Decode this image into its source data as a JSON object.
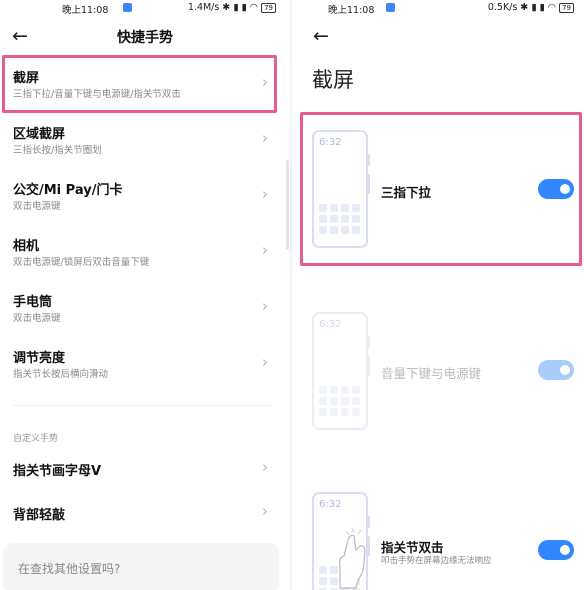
{
  "status_left": {
    "time": "晚上11:08",
    "speed": "1.4M/s",
    "battery": "79"
  },
  "status_right": {
    "time": "晚上11:08",
    "speed": "0.5K/s",
    "battery": "79"
  },
  "left": {
    "title": "快捷手势",
    "items": [
      {
        "title": "截屏",
        "subtitle": "三指下拉/音量下键与电源键/指关节双击"
      },
      {
        "title": "区域截屏",
        "subtitle": "三指长按/指关节圈划"
      },
      {
        "title": "公交/Mi Pay/门卡",
        "subtitle": "双击电源键"
      },
      {
        "title": "相机",
        "subtitle": "双击电源键/锁屏后双击音量下键"
      },
      {
        "title": "手电筒",
        "subtitle": "双击电源键"
      },
      {
        "title": "调节亮度",
        "subtitle": "指关节长按后横向滑动"
      }
    ],
    "custom_section": "自定义手势",
    "custom_items": [
      {
        "title": "指关节画字母V"
      },
      {
        "title": "背部轻敲"
      }
    ],
    "search_placeholder": "在查找其他设置吗?"
  },
  "right": {
    "title": "截屏",
    "options": [
      {
        "label": "三指下拉",
        "enabled": true,
        "phone_time": "6:32"
      },
      {
        "label": "音量下键与电源键",
        "enabled": true,
        "disabled": true,
        "phone_time": "6:32"
      },
      {
        "label": "指关节双击",
        "subtitle": "叩击手势在屏幕边缘无法响应",
        "enabled": true,
        "phone_time": "6:32"
      }
    ]
  },
  "colors": {
    "accent": "#3087ff",
    "highlight": "#e65c8c"
  }
}
